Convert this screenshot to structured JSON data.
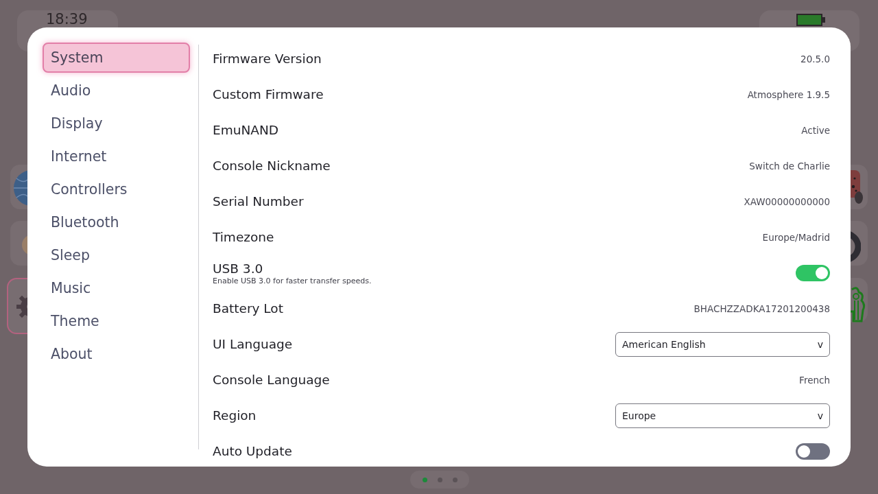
{
  "status_bar": {
    "time": "18:39"
  },
  "home_tiles": {
    "left": [
      {
        "kind": "globe",
        "selected": false
      },
      {
        "kind": "avatar",
        "selected": false
      },
      {
        "kind": "gear",
        "selected": true
      }
    ],
    "right": [
      {
        "kind": "controller",
        "selected": false
      },
      {
        "kind": "ring",
        "selected": false
      },
      {
        "kind": "person",
        "selected": false
      }
    ]
  },
  "sidebar": {
    "items": [
      {
        "label": "System",
        "selected": true
      },
      {
        "label": "Audio",
        "selected": false
      },
      {
        "label": "Display",
        "selected": false
      },
      {
        "label": "Internet",
        "selected": false
      },
      {
        "label": "Controllers",
        "selected": false
      },
      {
        "label": "Bluetooth",
        "selected": false
      },
      {
        "label": "Sleep",
        "selected": false
      },
      {
        "label": "Music",
        "selected": false
      },
      {
        "label": "Theme",
        "selected": false
      },
      {
        "label": "About",
        "selected": false
      }
    ]
  },
  "settings": {
    "rows": [
      {
        "kind": "value",
        "label": "Firmware Version",
        "value": "20.5.0"
      },
      {
        "kind": "value",
        "label": "Custom Firmware",
        "value": "Atmosphere 1.9.5"
      },
      {
        "kind": "value",
        "label": "EmuNAND",
        "value": "Active"
      },
      {
        "kind": "value",
        "label": "Console Nickname",
        "value": "Switch de Charlie"
      },
      {
        "kind": "value",
        "label": "Serial Number",
        "value": "XAW00000000000"
      },
      {
        "kind": "value",
        "label": "Timezone",
        "value": "Europe/Madrid"
      },
      {
        "kind": "toggle",
        "label": "USB 3.0",
        "description": "Enable USB 3.0 for faster transfer speeds.",
        "on": true
      },
      {
        "kind": "value",
        "label": "Battery Lot",
        "value": "BHACHZZADKA17201200438"
      },
      {
        "kind": "dropdown",
        "label": "UI Language",
        "value": "American English",
        "caret": "v"
      },
      {
        "kind": "value",
        "label": "Console Language",
        "value": "French"
      },
      {
        "kind": "dropdown",
        "label": "Region",
        "value": "Europe",
        "caret": "v"
      },
      {
        "kind": "toggle",
        "label": "Auto Update",
        "on": false
      }
    ]
  },
  "page_indicator": {
    "dots": [
      {
        "selected": true
      },
      {
        "selected": false
      },
      {
        "selected": false
      }
    ]
  }
}
